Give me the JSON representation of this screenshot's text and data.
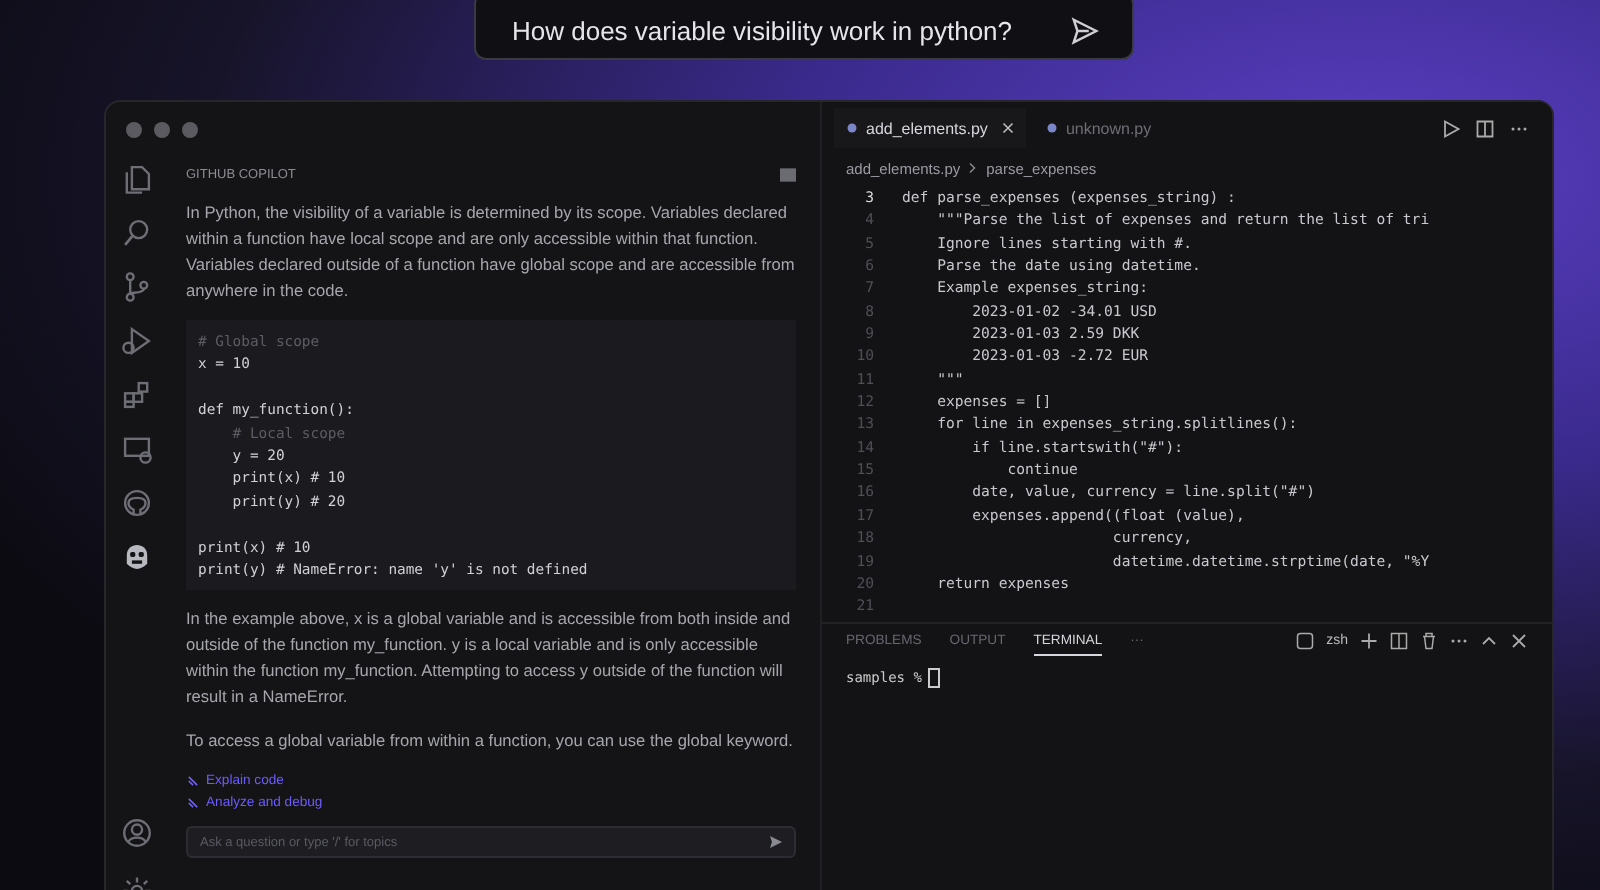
{
  "prompt": {
    "text": "How does variable visibility work in python?"
  },
  "chat": {
    "title": "GITHUB COPILOT",
    "intro": "In Python, the visibility of a variable is determined by its scope. Variables declared within a function have local scope and are only accessible within that function. Variables declared outside of a function have global scope and are accessible from anywhere in the code.",
    "code": [
      {
        "kind": "comment",
        "text": "# Global scope"
      },
      {
        "kind": "code",
        "text": "x = 10"
      },
      {
        "kind": "blank"
      },
      {
        "kind": "code",
        "text": "def my_function():"
      },
      {
        "kind": "comment",
        "text": "    # Local scope"
      },
      {
        "kind": "code",
        "text": "    y = 20"
      },
      {
        "kind": "code",
        "text": "    print(x) # 10"
      },
      {
        "kind": "code",
        "text": "    print(y) # 20"
      },
      {
        "kind": "blank"
      },
      {
        "kind": "code",
        "text": "print(x) # 10"
      },
      {
        "kind": "code",
        "text": "print(y) # NameError: name 'y' is not defined"
      }
    ],
    "explanation": "In the example above, x is a global variable and is accessible from both inside and outside of the function my_function. y is a local variable and is only accessible within the function my_function. Attempting to access y outside of the function will result in a NameError.",
    "closing": "To access a global variable from within a function, you can use the global keyword.",
    "suggestions": [
      "Explain code",
      "Analyze and debug"
    ],
    "input": {
      "placeholder": "Ask a question or type '/' for topics"
    }
  },
  "editor": {
    "tabs": [
      {
        "label": "add_elements.py",
        "selected": true
      },
      {
        "label": "unknown.py",
        "selected": false
      }
    ],
    "breadcrumb": [
      "add_elements.py",
      "parse_expenses"
    ],
    "lines": [
      {
        "number": "3",
        "text": "def parse_expenses (expenses_string) :",
        "current": true
      },
      {
        "number": "4",
        "text": "    \"\"\"Parse the list of expenses and return the list of tri",
        "current": false
      },
      {
        "number": "5",
        "text": "    Ignore lines starting with #.",
        "current": false
      },
      {
        "number": "6",
        "text": "    Parse the date using datetime.",
        "current": false
      },
      {
        "number": "7",
        "text": "    Example expenses_string:",
        "current": false
      },
      {
        "number": "8",
        "text": "        2023-01-02 -34.01 USD",
        "current": false
      },
      {
        "number": "9",
        "text": "        2023-01-03 2.59 DKK",
        "current": false
      },
      {
        "number": "10",
        "text": "        2023-01-03 -2.72 EUR",
        "current": false
      },
      {
        "number": "11",
        "text": "    \"\"\"",
        "current": false
      },
      {
        "number": "12",
        "text": "    expenses = []",
        "current": false
      },
      {
        "number": "13",
        "text": "    for line in expenses_string.splitlines():",
        "current": false
      },
      {
        "number": "14",
        "text": "        if line.startswith(\"#\"):",
        "current": false
      },
      {
        "number": "15",
        "text": "            continue",
        "current": false
      },
      {
        "number": "16",
        "text": "        date, value, currency = line.split(\"#\")",
        "current": false
      },
      {
        "number": "17",
        "text": "        expenses.append((float (value),",
        "current": false
      },
      {
        "number": "18",
        "text": "                        currency,",
        "current": false
      },
      {
        "number": "19",
        "text": "                        datetime.datetime.strptime(date, \"%Y",
        "current": false
      },
      {
        "number": "20",
        "text": "    return expenses",
        "current": false
      },
      {
        "number": "21",
        "current": false
      }
    ]
  },
  "panel": {
    "tabs": [
      {
        "label": "PROBLEMS",
        "selected": false
      },
      {
        "label": "OUTPUT",
        "selected": false
      },
      {
        "label": "TERMINAL",
        "selected": true
      },
      {
        "label": "···",
        "selected": false
      }
    ],
    "shell": "zsh",
    "terminal_line": "samples %"
  }
}
